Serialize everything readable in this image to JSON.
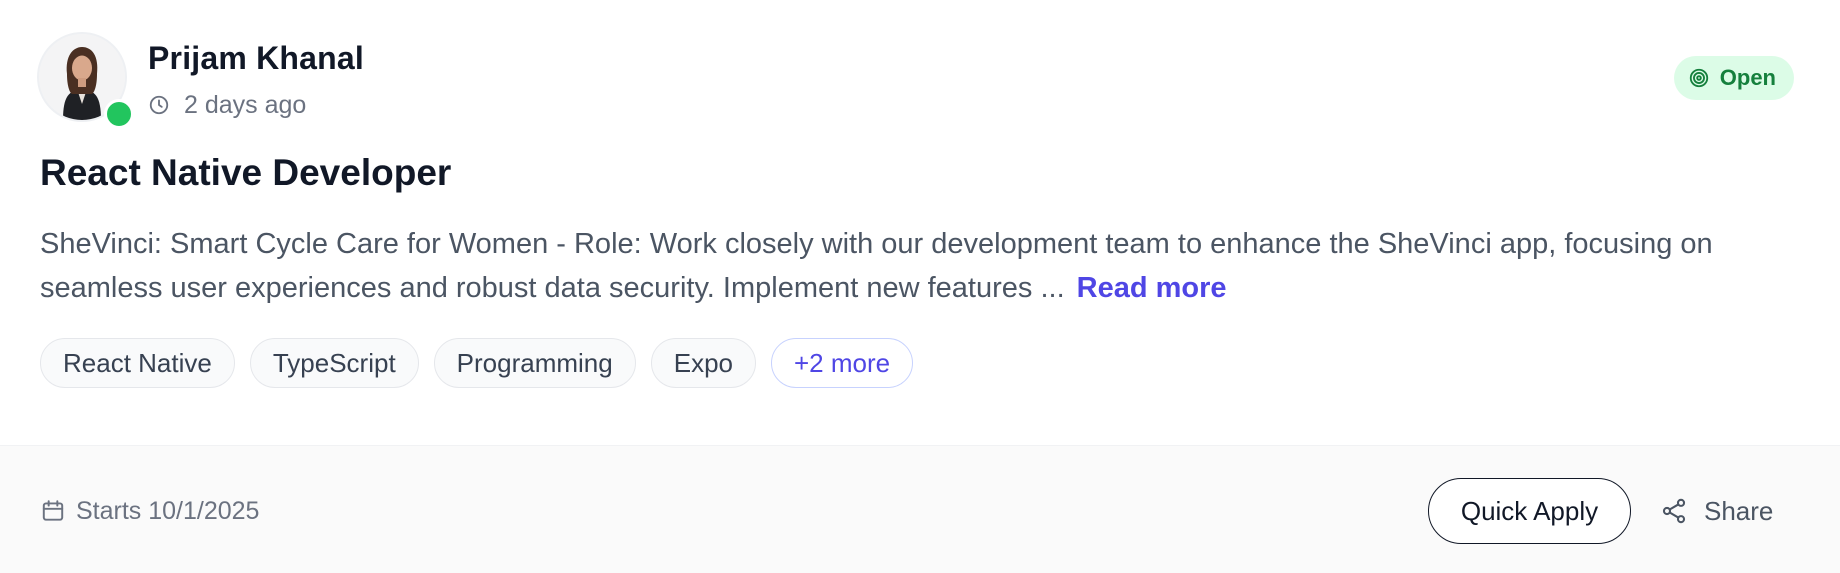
{
  "author": {
    "name": "Prijam Khanal",
    "posted": "2 days ago",
    "online": true
  },
  "status": {
    "label": "Open",
    "color": "#15803d",
    "background": "#dcfce7"
  },
  "job": {
    "title": "React Native Developer",
    "description": "SheVinci: Smart Cycle Care for Women - Role: Work closely with our development team to enhance the SheVinci app, focusing on seamless user experiences and robust data security. Implement new features ...",
    "read_more": "Read more"
  },
  "tags": [
    "React Native",
    "TypeScript",
    "Programming",
    "Expo"
  ],
  "more_tags": "+2 more",
  "footer": {
    "start": "Starts 10/1/2025",
    "quick_apply": "Quick Apply",
    "share": "Share"
  },
  "icons": {
    "clock": "clock-icon",
    "target": "target-icon",
    "calendar": "calendar-icon",
    "share": "share-icon"
  },
  "colors": {
    "accent": "#4f46e5",
    "online": "#22c55e",
    "title": "#111827",
    "muted": "#6b7280"
  }
}
